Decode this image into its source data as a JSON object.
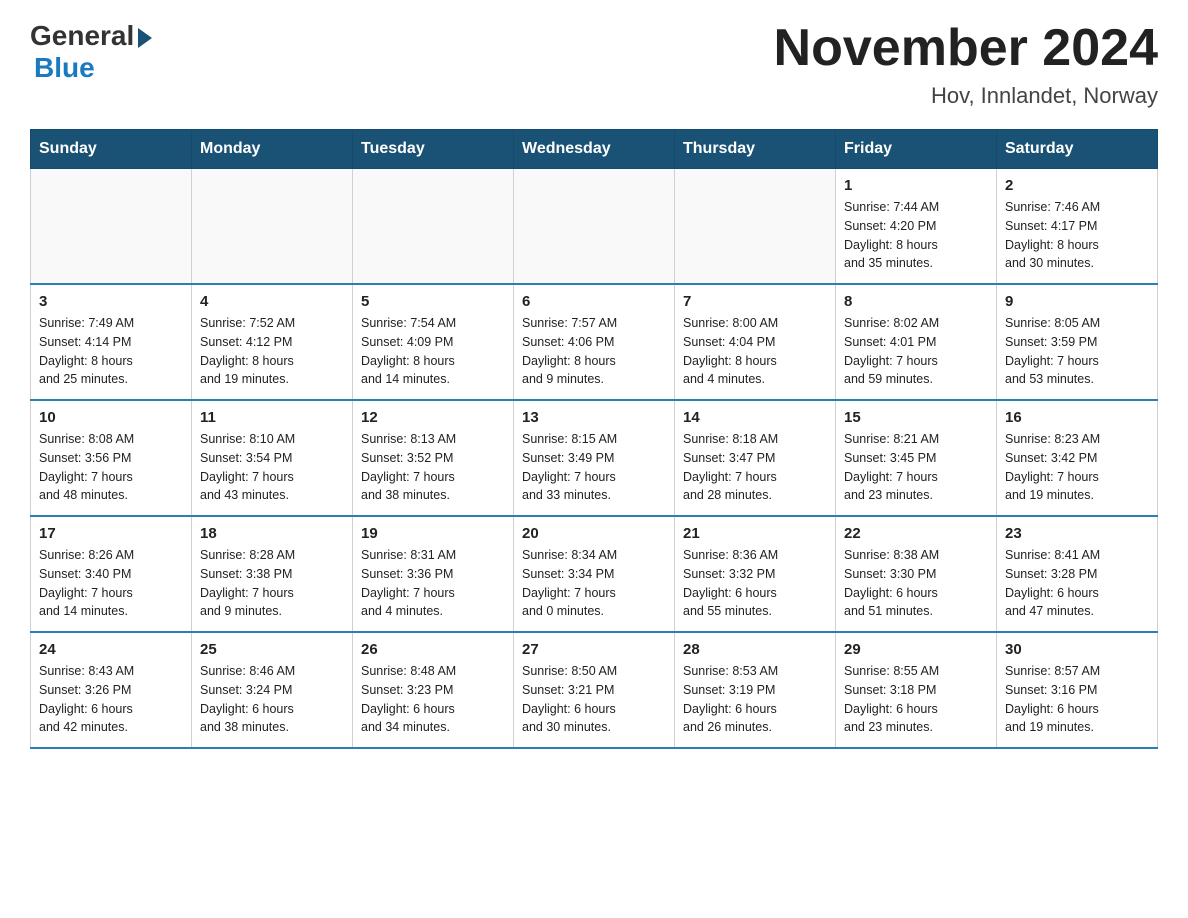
{
  "header": {
    "logo_general": "General",
    "logo_blue": "Blue",
    "title": "November 2024",
    "subtitle": "Hov, Innlandet, Norway"
  },
  "days_of_week": [
    "Sunday",
    "Monday",
    "Tuesday",
    "Wednesday",
    "Thursday",
    "Friday",
    "Saturday"
  ],
  "weeks": [
    [
      {
        "day": "",
        "info": ""
      },
      {
        "day": "",
        "info": ""
      },
      {
        "day": "",
        "info": ""
      },
      {
        "day": "",
        "info": ""
      },
      {
        "day": "",
        "info": ""
      },
      {
        "day": "1",
        "info": "Sunrise: 7:44 AM\nSunset: 4:20 PM\nDaylight: 8 hours\nand 35 minutes."
      },
      {
        "day": "2",
        "info": "Sunrise: 7:46 AM\nSunset: 4:17 PM\nDaylight: 8 hours\nand 30 minutes."
      }
    ],
    [
      {
        "day": "3",
        "info": "Sunrise: 7:49 AM\nSunset: 4:14 PM\nDaylight: 8 hours\nand 25 minutes."
      },
      {
        "day": "4",
        "info": "Sunrise: 7:52 AM\nSunset: 4:12 PM\nDaylight: 8 hours\nand 19 minutes."
      },
      {
        "day": "5",
        "info": "Sunrise: 7:54 AM\nSunset: 4:09 PM\nDaylight: 8 hours\nand 14 minutes."
      },
      {
        "day": "6",
        "info": "Sunrise: 7:57 AM\nSunset: 4:06 PM\nDaylight: 8 hours\nand 9 minutes."
      },
      {
        "day": "7",
        "info": "Sunrise: 8:00 AM\nSunset: 4:04 PM\nDaylight: 8 hours\nand 4 minutes."
      },
      {
        "day": "8",
        "info": "Sunrise: 8:02 AM\nSunset: 4:01 PM\nDaylight: 7 hours\nand 59 minutes."
      },
      {
        "day": "9",
        "info": "Sunrise: 8:05 AM\nSunset: 3:59 PM\nDaylight: 7 hours\nand 53 minutes."
      }
    ],
    [
      {
        "day": "10",
        "info": "Sunrise: 8:08 AM\nSunset: 3:56 PM\nDaylight: 7 hours\nand 48 minutes."
      },
      {
        "day": "11",
        "info": "Sunrise: 8:10 AM\nSunset: 3:54 PM\nDaylight: 7 hours\nand 43 minutes."
      },
      {
        "day": "12",
        "info": "Sunrise: 8:13 AM\nSunset: 3:52 PM\nDaylight: 7 hours\nand 38 minutes."
      },
      {
        "day": "13",
        "info": "Sunrise: 8:15 AM\nSunset: 3:49 PM\nDaylight: 7 hours\nand 33 minutes."
      },
      {
        "day": "14",
        "info": "Sunrise: 8:18 AM\nSunset: 3:47 PM\nDaylight: 7 hours\nand 28 minutes."
      },
      {
        "day": "15",
        "info": "Sunrise: 8:21 AM\nSunset: 3:45 PM\nDaylight: 7 hours\nand 23 minutes."
      },
      {
        "day": "16",
        "info": "Sunrise: 8:23 AM\nSunset: 3:42 PM\nDaylight: 7 hours\nand 19 minutes."
      }
    ],
    [
      {
        "day": "17",
        "info": "Sunrise: 8:26 AM\nSunset: 3:40 PM\nDaylight: 7 hours\nand 14 minutes."
      },
      {
        "day": "18",
        "info": "Sunrise: 8:28 AM\nSunset: 3:38 PM\nDaylight: 7 hours\nand 9 minutes."
      },
      {
        "day": "19",
        "info": "Sunrise: 8:31 AM\nSunset: 3:36 PM\nDaylight: 7 hours\nand 4 minutes."
      },
      {
        "day": "20",
        "info": "Sunrise: 8:34 AM\nSunset: 3:34 PM\nDaylight: 7 hours\nand 0 minutes."
      },
      {
        "day": "21",
        "info": "Sunrise: 8:36 AM\nSunset: 3:32 PM\nDaylight: 6 hours\nand 55 minutes."
      },
      {
        "day": "22",
        "info": "Sunrise: 8:38 AM\nSunset: 3:30 PM\nDaylight: 6 hours\nand 51 minutes."
      },
      {
        "day": "23",
        "info": "Sunrise: 8:41 AM\nSunset: 3:28 PM\nDaylight: 6 hours\nand 47 minutes."
      }
    ],
    [
      {
        "day": "24",
        "info": "Sunrise: 8:43 AM\nSunset: 3:26 PM\nDaylight: 6 hours\nand 42 minutes."
      },
      {
        "day": "25",
        "info": "Sunrise: 8:46 AM\nSunset: 3:24 PM\nDaylight: 6 hours\nand 38 minutes."
      },
      {
        "day": "26",
        "info": "Sunrise: 8:48 AM\nSunset: 3:23 PM\nDaylight: 6 hours\nand 34 minutes."
      },
      {
        "day": "27",
        "info": "Sunrise: 8:50 AM\nSunset: 3:21 PM\nDaylight: 6 hours\nand 30 minutes."
      },
      {
        "day": "28",
        "info": "Sunrise: 8:53 AM\nSunset: 3:19 PM\nDaylight: 6 hours\nand 26 minutes."
      },
      {
        "day": "29",
        "info": "Sunrise: 8:55 AM\nSunset: 3:18 PM\nDaylight: 6 hours\nand 23 minutes."
      },
      {
        "day": "30",
        "info": "Sunrise: 8:57 AM\nSunset: 3:16 PM\nDaylight: 6 hours\nand 19 minutes."
      }
    ]
  ]
}
